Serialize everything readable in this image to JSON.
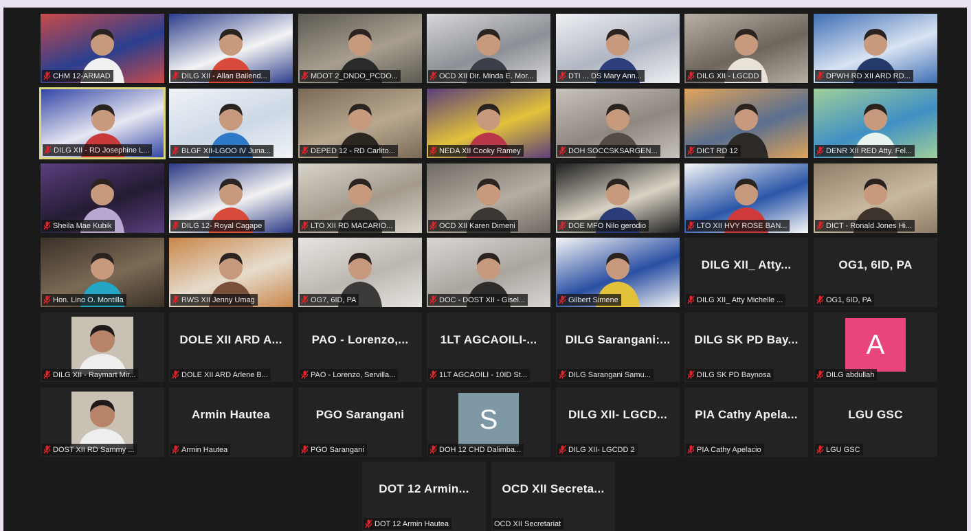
{
  "colors": {
    "background": "#1a1a1a",
    "tile": "#232323",
    "active_speaker_border": "#dcd87a",
    "muted_icon": "#e0242b",
    "avatar_pink": "#e8457a",
    "avatar_gray": "#7f98a6"
  },
  "participants": [
    {
      "name": "CHM 12-ARMAD",
      "tile_type": "video"
    },
    {
      "name": "DILG XII - Allan Bailend...",
      "tile_type": "video"
    },
    {
      "name": "MDOT 2_DNDO_PCDO...",
      "tile_type": "video"
    },
    {
      "name": "OCD XII Dir. Minda E. Mor...",
      "tile_type": "video"
    },
    {
      "name": "DTI ... DS Mary Ann...",
      "tile_type": "video"
    },
    {
      "name": "DILG XII - LGCDD",
      "tile_type": "video"
    },
    {
      "name": "DPWH RD XII ARD RD...",
      "tile_type": "video"
    },
    {
      "name": "DILG XII - RD Josephine L...",
      "tile_type": "video",
      "active": true
    },
    {
      "name": "BLGF XII-LGOO IV Juna...",
      "tile_type": "video"
    },
    {
      "name": "DEPED 12 - RD Carlito...",
      "tile_type": "video"
    },
    {
      "name": "NEDA XII Cooky Ramey",
      "tile_type": "video"
    },
    {
      "name": "DOH SOCCSKSARGEN...",
      "tile_type": "video"
    },
    {
      "name": "DICT RD 12",
      "tile_type": "video"
    },
    {
      "name": "DENR XII RED Atty. Fel...",
      "tile_type": "video"
    },
    {
      "name": "Sheila Mae Kubik",
      "tile_type": "video"
    },
    {
      "name": "DILG 12- Royal Cagape",
      "tile_type": "video"
    },
    {
      "name": "LTO XII RD MACARIO...",
      "tile_type": "video"
    },
    {
      "name": "OCD XII Karen Dimeni",
      "tile_type": "video"
    },
    {
      "name": "DOE MFO Nilo gerodio",
      "tile_type": "video"
    },
    {
      "name": "LTO XII HVY ROSE BAN...",
      "tile_type": "video"
    },
    {
      "name": "DICT - Ronald Jones Hi...",
      "tile_type": "video"
    },
    {
      "name": "Hon. Lino O. Montilla",
      "tile_type": "video"
    },
    {
      "name": "RWS XII Jenny Umag",
      "tile_type": "video"
    },
    {
      "name": "OG7, 6ID, PA",
      "tile_type": "video"
    },
    {
      "name": "DOC - DOST XII - Gisel...",
      "tile_type": "video"
    },
    {
      "name": "Gilbert Simene",
      "tile_type": "video"
    },
    {
      "name": "DILG XII_ Atty Michelle ...",
      "tile_type": "name",
      "display_name": "DILG XII_ Atty..."
    },
    {
      "name": "OG1, 6ID, PA",
      "tile_type": "name",
      "display_name": "OG1, 6ID, PA"
    },
    {
      "name": "DILG XII - Raymart Mir...",
      "tile_type": "photo"
    },
    {
      "name": "DOLE XII ARD Arlene B...",
      "tile_type": "name",
      "display_name": "DOLE XII ARD A..."
    },
    {
      "name": "PAO - Lorenzo, Servilla...",
      "tile_type": "name",
      "display_name": "PAO - Lorenzo,..."
    },
    {
      "name": "1LT AGCAOILI - 10ID St...",
      "tile_type": "name",
      "display_name": "1LT AGCAOILI-..."
    },
    {
      "name": "DILG Sarangani Samu...",
      "tile_type": "name",
      "display_name": "DILG Sarangani:..."
    },
    {
      "name": "DILG SK PD Baynosa",
      "tile_type": "name",
      "display_name": "DILG SK PD Bay..."
    },
    {
      "name": "DILG abdullah",
      "tile_type": "avatar",
      "avatar_letter": "A",
      "avatar_color": "#e8457a"
    },
    {
      "name": "DOST XII RD Sammy ...",
      "tile_type": "photo"
    },
    {
      "name": "Armin Hautea",
      "tile_type": "name",
      "display_name": "Armin Hautea"
    },
    {
      "name": "PGO Sarangani",
      "tile_type": "name",
      "display_name": "PGO Sarangani"
    },
    {
      "name": "DOH 12 CHD Dalimba...",
      "tile_type": "avatar",
      "avatar_letter": "S",
      "avatar_color": "#7f98a6"
    },
    {
      "name": "DILG XII- LGCDD 2",
      "tile_type": "name",
      "display_name": "DILG XII- LGCD..."
    },
    {
      "name": "PIA Cathy Apelacio",
      "tile_type": "name",
      "display_name": "PIA Cathy Apela..."
    },
    {
      "name": "LGU GSC",
      "tile_type": "name",
      "display_name": "LGU GSC"
    },
    {
      "name": "DOT 12 Armin Hautea",
      "tile_type": "name",
      "display_name": "DOT 12 Armin..."
    },
    {
      "name": "OCD XII Secretariat",
      "tile_type": "name",
      "display_name": "OCD XII Secreta...",
      "muted": false
    }
  ]
}
